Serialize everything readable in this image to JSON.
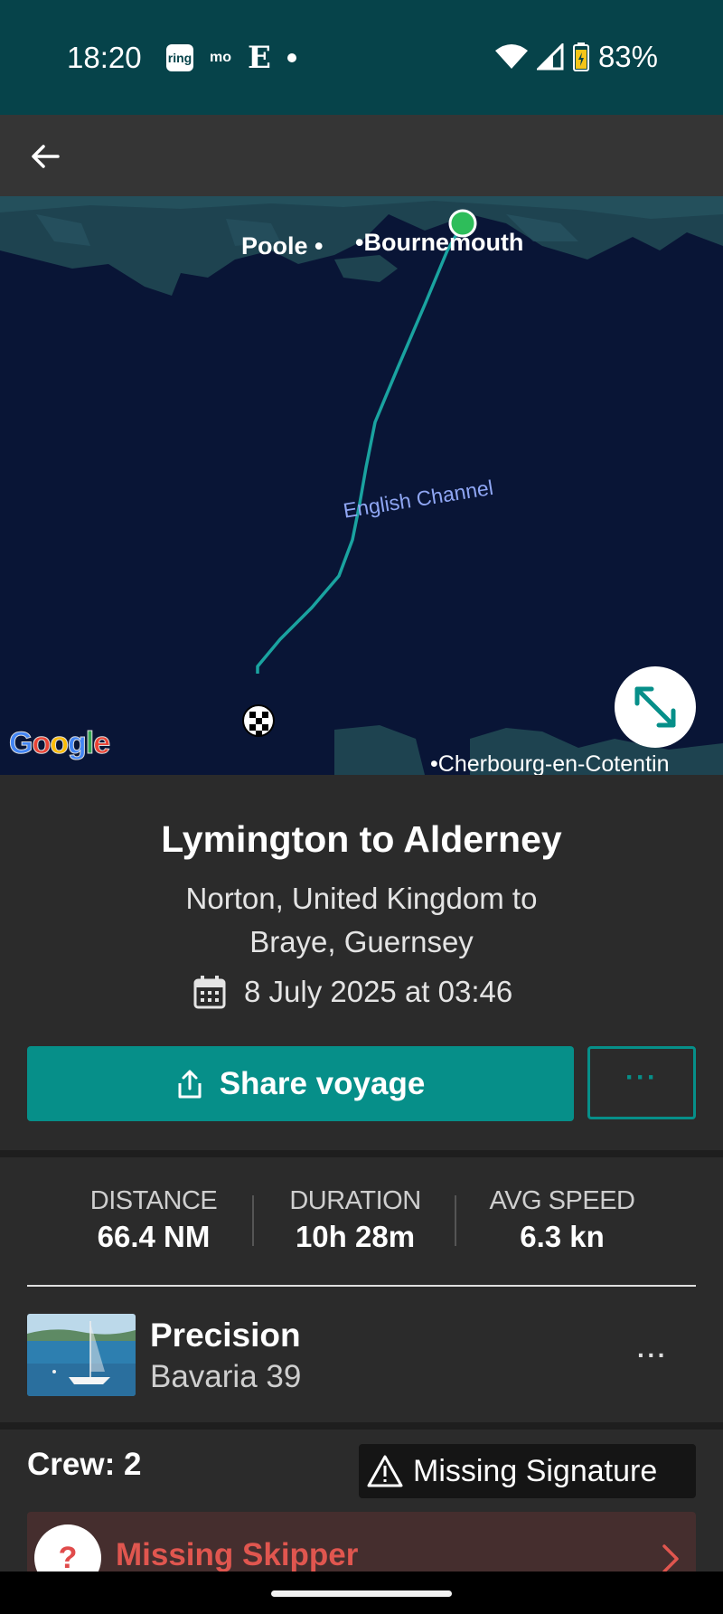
{
  "status_bar": {
    "time": "18:20",
    "notification_icons": [
      "ring",
      "mo",
      "E"
    ],
    "ring_text": "ring",
    "mo_text": "mo",
    "e_text": "E",
    "battery": "83%"
  },
  "map": {
    "labels": {
      "poole": "Poole",
      "bournemouth": "Bournemouth",
      "channel": "English Channel",
      "cherbourg": "Cherbourg-en-Cotentin"
    },
    "google_logo": "Google",
    "colors": {
      "water": "#091536",
      "land": "#1e4350",
      "track": "#1aa3a0",
      "start": "#2ebd5a"
    }
  },
  "voyage": {
    "title": "Lymington to Alderney",
    "route": "Norton, United Kingdom to Braye, Guernsey",
    "date": "8 July 2025 at 03:46",
    "share_label": "Share voyage",
    "more_label": "···"
  },
  "stats": [
    {
      "label": "DISTANCE",
      "value": "66.4 NM"
    },
    {
      "label": "DURATION",
      "value": "10h 28m"
    },
    {
      "label": "AVG SPEED",
      "value": "6.3 kn"
    }
  ],
  "boat": {
    "name": "Precision",
    "model": "Bavaria 39",
    "more_label": "···"
  },
  "crew": {
    "label": "Crew: 2",
    "missing_signature": "Missing Signature",
    "missing_skipper": "Missing Skipper",
    "skipper_icon": "?"
  },
  "accent_color": "#068f89"
}
